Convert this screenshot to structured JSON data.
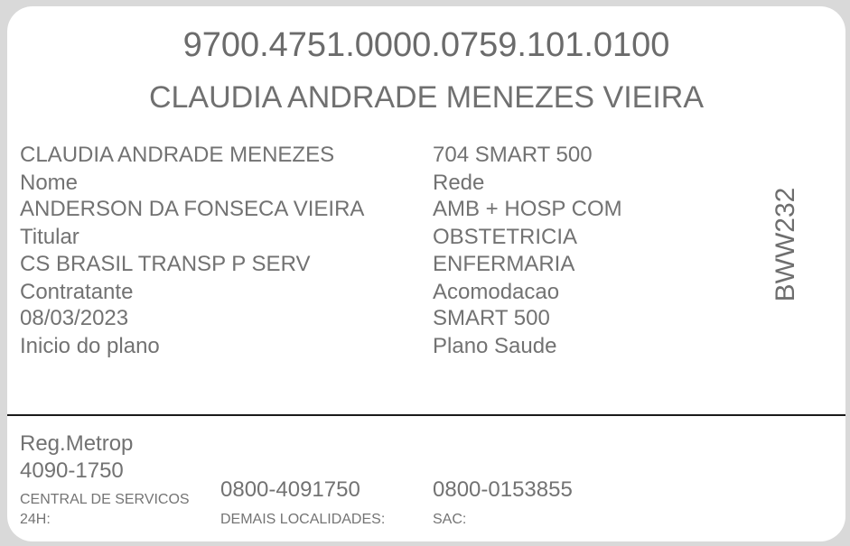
{
  "card": {
    "number": "9700.4751.0000.0759.101.0100",
    "name": "CLAUDIA ANDRADE MENEZES VIEIRA",
    "left_column": [
      {
        "value": "CLAUDIA ANDRADE MENEZES",
        "label": "Nome"
      },
      {
        "value": "ANDERSON DA FONSECA VIEIRA",
        "label": "Titular"
      },
      {
        "value": "CS BRASIL TRANSP P SERV",
        "label": "Contratante"
      },
      {
        "value": "08/03/2023",
        "label": "Inicio do plano"
      }
    ],
    "right_column": [
      {
        "value": "704 SMART 500",
        "label": "Rede"
      },
      {
        "value": "AMB + HOSP COM",
        "label": ""
      },
      {
        "value": "OBSTETRICIA",
        "label": ""
      },
      {
        "value": "ENFERMARIA",
        "label": "Acomodacao"
      },
      {
        "value": "SMART 500",
        "label": "Plano Saude"
      }
    ],
    "vertical_code": "BWW232"
  },
  "footer": {
    "reg_label": "Reg.Metrop",
    "reg_phone": "4090-1750",
    "central_label_line1": "CENTRAL DE SERVICOS",
    "central_label_line2": "24H:",
    "demais_phone": "0800-4091750",
    "demais_label": "DEMAIS LOCALIDADES:",
    "sac_phone": "0800-0153855",
    "sac_label": "SAC:"
  }
}
